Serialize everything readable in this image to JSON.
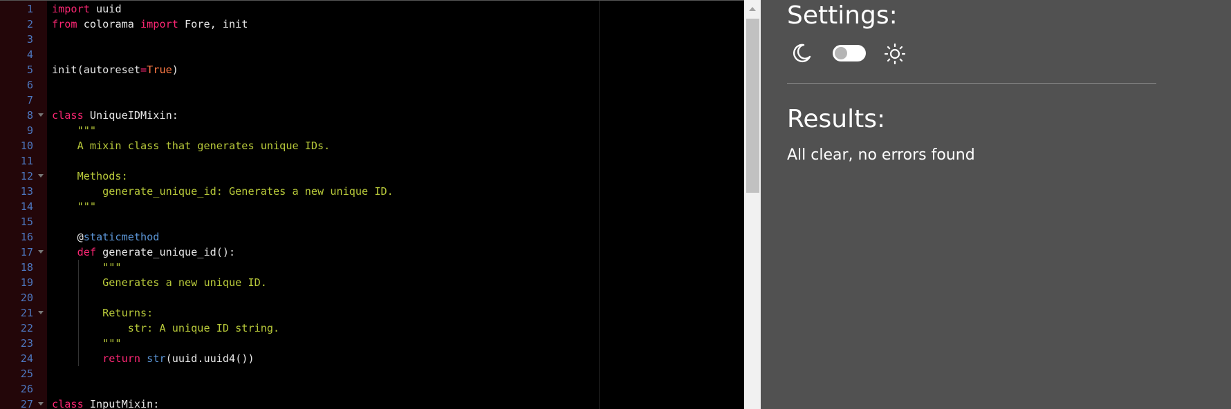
{
  "editor": {
    "lines": [
      {
        "n": "1",
        "fold": false,
        "tokens": [
          [
            "kw",
            "import"
          ],
          [
            "id",
            " uuid"
          ]
        ]
      },
      {
        "n": "2",
        "fold": false,
        "tokens": [
          [
            "kw",
            "from"
          ],
          [
            "id",
            " colorama "
          ],
          [
            "kw",
            "import"
          ],
          [
            "id",
            " Fore, init"
          ]
        ]
      },
      {
        "n": "3",
        "fold": false,
        "tokens": []
      },
      {
        "n": "4",
        "fold": false,
        "tokens": []
      },
      {
        "n": "5",
        "fold": false,
        "tokens": [
          [
            "id",
            "init(autoreset"
          ],
          [
            "op",
            "="
          ],
          [
            "bool",
            "True"
          ],
          [
            "id",
            ")"
          ]
        ]
      },
      {
        "n": "6",
        "fold": false,
        "tokens": []
      },
      {
        "n": "7",
        "fold": false,
        "tokens": []
      },
      {
        "n": "8",
        "fold": true,
        "tokens": [
          [
            "kw",
            "class"
          ],
          [
            "id",
            " UniqueIDMixin:"
          ]
        ]
      },
      {
        "n": "9",
        "fold": false,
        "tokens": [
          [
            "str",
            "    \"\"\""
          ]
        ]
      },
      {
        "n": "10",
        "fold": false,
        "tokens": [
          [
            "str",
            "    A mixin class that generates unique IDs."
          ]
        ]
      },
      {
        "n": "11",
        "fold": false,
        "tokens": []
      },
      {
        "n": "12",
        "fold": true,
        "tokens": [
          [
            "str",
            "    Methods:"
          ]
        ]
      },
      {
        "n": "13",
        "fold": false,
        "tokens": [
          [
            "str",
            "        generate_unique_id: Generates a new unique ID."
          ]
        ]
      },
      {
        "n": "14",
        "fold": false,
        "tokens": [
          [
            "str",
            "    \"\"\""
          ]
        ]
      },
      {
        "n": "15",
        "fold": false,
        "tokens": []
      },
      {
        "n": "16",
        "fold": false,
        "tokens": [
          [
            "id",
            "    @"
          ],
          [
            "deco",
            "staticmethod"
          ]
        ]
      },
      {
        "n": "17",
        "fold": true,
        "tokens": [
          [
            "kw",
            "    def"
          ],
          [
            "id",
            " generate_unique_id():"
          ]
        ]
      },
      {
        "n": "18",
        "fold": false,
        "tokens": [
          [
            "str",
            "        \"\"\""
          ]
        ]
      },
      {
        "n": "19",
        "fold": false,
        "tokens": [
          [
            "str",
            "        Generates a new unique ID."
          ]
        ]
      },
      {
        "n": "20",
        "fold": false,
        "tokens": []
      },
      {
        "n": "21",
        "fold": true,
        "tokens": [
          [
            "str",
            "        Returns:"
          ]
        ]
      },
      {
        "n": "22",
        "fold": false,
        "tokens": [
          [
            "str",
            "            str: A unique ID string."
          ]
        ]
      },
      {
        "n": "23",
        "fold": false,
        "tokens": [
          [
            "str",
            "        \"\"\""
          ]
        ]
      },
      {
        "n": "24",
        "fold": false,
        "tokens": [
          [
            "kw",
            "        return"
          ],
          [
            "id",
            " "
          ],
          [
            "fn",
            "str"
          ],
          [
            "id",
            "(uuid.uuid4())"
          ]
        ]
      },
      {
        "n": "25",
        "fold": false,
        "tokens": []
      },
      {
        "n": "26",
        "fold": false,
        "tokens": []
      },
      {
        "n": "27",
        "fold": true,
        "tokens": [
          [
            "kw",
            "class"
          ],
          [
            "id",
            " InputMixin:"
          ]
        ]
      }
    ]
  },
  "settings": {
    "title": "Settings:",
    "theme_toggle": {
      "left_icon": "moon-icon",
      "right_icon": "sun-icon",
      "state": "off"
    }
  },
  "results": {
    "title": "Results:",
    "message": "All clear, no errors found"
  },
  "colors": {
    "editor_bg": "#000000",
    "gutter_bg": "#230609",
    "line_number": "#4d77bf",
    "keyword": "#f92672",
    "string": "#b8c93a",
    "boolean": "#ff7a45",
    "panel_bg": "#515151"
  }
}
